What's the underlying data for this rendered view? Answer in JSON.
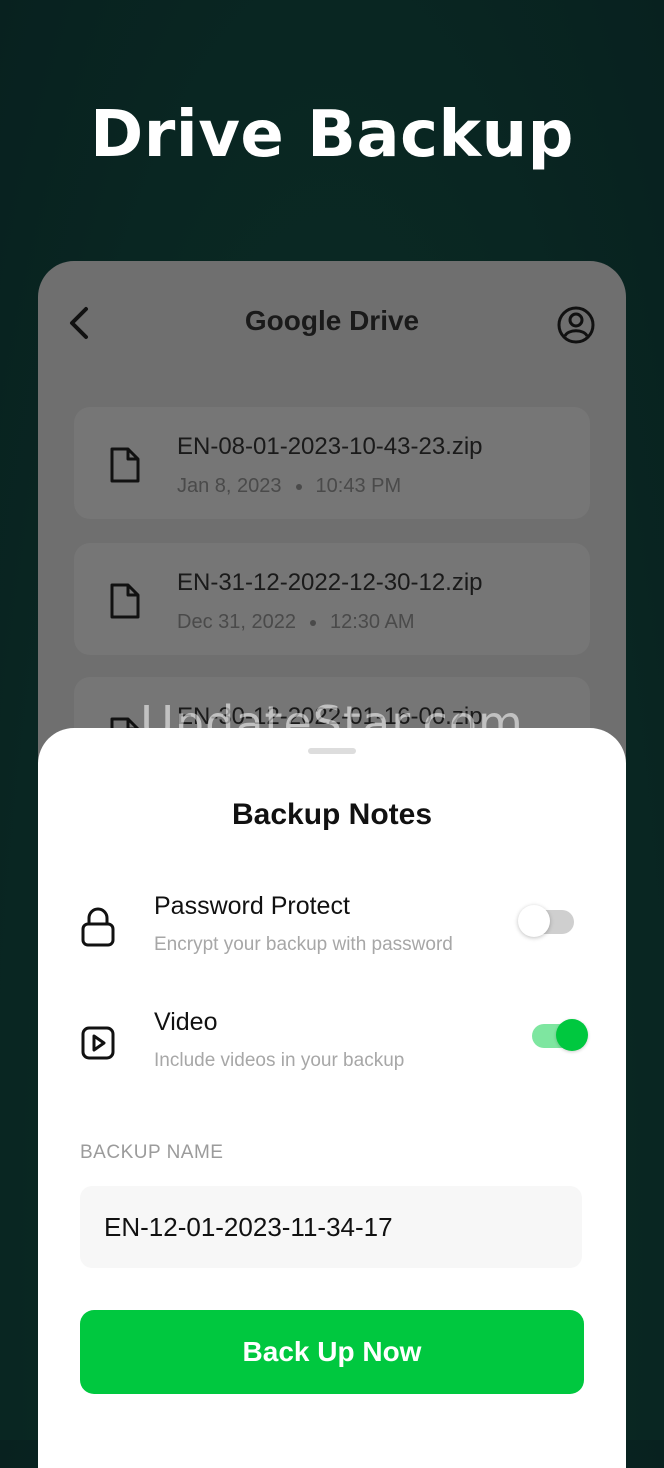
{
  "hero": {
    "title": "Drive Backup"
  },
  "drive": {
    "title": "Google Drive",
    "files": [
      {
        "name": "EN-08-01-2023-10-43-23.zip",
        "date": "Jan 8, 2023",
        "time": "10:43 PM"
      },
      {
        "name": "EN-31-12-2022-12-30-12.zip",
        "date": "Dec 31, 2022",
        "time": "12:30 AM"
      },
      {
        "name": "EN-30-12-2022-01-16-00.zip",
        "date": "",
        "time": ""
      }
    ]
  },
  "watermark": "UpdateStar.com",
  "sheet": {
    "title": "Backup Notes",
    "options": [
      {
        "title": "Password Protect",
        "subtitle": "Encrypt your backup with password",
        "enabled": false
      },
      {
        "title": "Video",
        "subtitle": "Include videos in your backup",
        "enabled": true
      }
    ],
    "backup_name_label": "BACKUP NAME",
    "backup_name_value": "EN-12-01-2023-11-34-17",
    "cta_label": "Back Up Now"
  },
  "colors": {
    "accent": "#00c83f",
    "toggle_on_track": "#7ee6a0"
  }
}
